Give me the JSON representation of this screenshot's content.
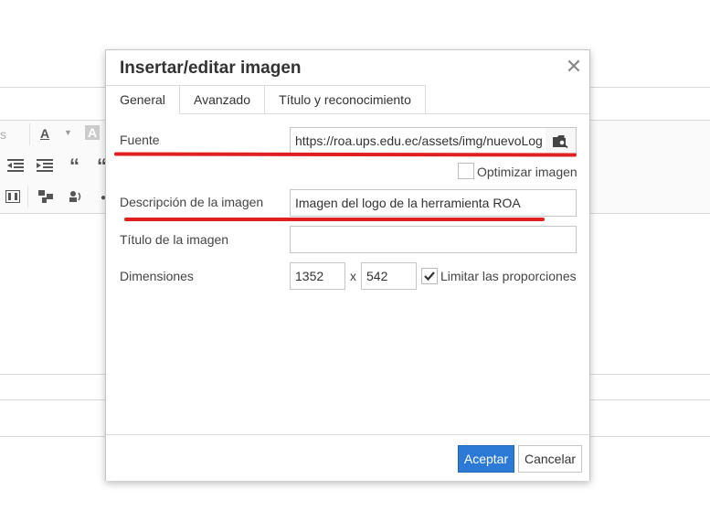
{
  "dialog": {
    "title": "Insertar/editar imagen",
    "close_glyph": "✕",
    "tabs": [
      {
        "label": "General"
      },
      {
        "label": "Avanzado"
      },
      {
        "label": "Título y reconocimiento"
      }
    ],
    "fields": {
      "source": {
        "label": "Fuente",
        "value": "https://roa.ups.edu.ec/assets/img/nuevoLog",
        "button_icon": "folder-search-icon"
      },
      "optimize": {
        "label": "Optimizar imagen",
        "checked": false
      },
      "description": {
        "label": "Descripción de la imagen",
        "value": "Imagen del logo de la herramienta ROA"
      },
      "title": {
        "label": "Título de la imagen",
        "value": ""
      },
      "dimensions": {
        "label": "Dimensiones",
        "width": "1352",
        "separator": "x",
        "height": "542"
      },
      "constrain": {
        "label": "Limitar las proporciones",
        "checked": true
      }
    },
    "buttons": {
      "ok": "Aceptar",
      "cancel": "Cancelar"
    },
    "annotation_color": "#e02020"
  },
  "editor_toolbar": {
    "partial_text": "s",
    "icons": [
      "font-color-icon",
      "background-color-icon",
      "outdent-icon",
      "indent-icon",
      "blockquote-icon",
      "media-icon",
      "template-icon",
      "accessibility-icon"
    ]
  },
  "colors": {
    "primary": "#2d7ad6",
    "border": "#c5c5c5"
  }
}
